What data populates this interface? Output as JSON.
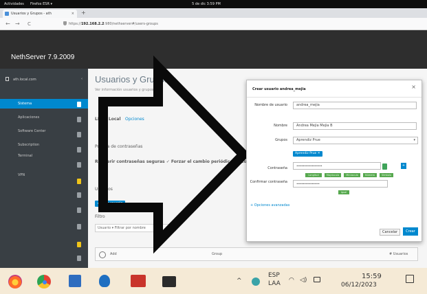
{
  "gnome": {
    "activities": "Actividades",
    "app_name": "Firefox ESR ▾",
    "clock": "5 de dic  3:59 PM"
  },
  "browser": {
    "tab_title": "Usuarios y Grupos - ath",
    "tab_close": "×",
    "new_tab": "+",
    "nav_back": "←",
    "nav_forward": "→",
    "nav_reload": "C",
    "url_prefix": "https://",
    "url_host": "192.168.2.2",
    "url_path": ":980/nethserver#/users-groups"
  },
  "app": {
    "brand": "NethServer 7.9.2009"
  },
  "sidebar": {
    "host": "ath.local.com",
    "host_arrow": "‹",
    "items": [
      {
        "label": "Sistema"
      },
      {
        "label": "Aplicaciones"
      },
      {
        "label": "Software Center"
      },
      {
        "label": "Subscription"
      },
      {
        "label": "Terminal"
      },
      {
        "label": "VPN"
      }
    ]
  },
  "page": {
    "title": "Usuarios y Grupos",
    "subtitle": "Ver información usuarios y grupos",
    "ldap_label": "LDAP Local",
    "ldap_link": "Opciones",
    "policy_heading": "Política de contraseñas",
    "policy_text": "Requerir contraseñas seguras  ✓  Forzar el cambio periódico de contraseña",
    "users_heading": "Usuarios",
    "users_button": "Añadir usuario",
    "filter_label": "Filtro",
    "filter_placeholder": "Usuario  ▾   Filtrar por nombre",
    "add_row": "Add",
    "footer_mid": "Group",
    "footer_right": "# Usuarios"
  },
  "modal": {
    "title": "Crear usuario andrea_mejia",
    "close": "×",
    "fields": {
      "username_label": "Nombre de usuario",
      "username_value": "andrea_mejia",
      "fullname_label": "Nombre",
      "fullname_value": "Andrea Mejia Mejia B",
      "groups_label": "Grupos",
      "groups_value": "Aprendiz Prue",
      "group_chip": "Aprendiz Prue ✕",
      "password_label": "Contraseña",
      "password_value": "••••••••••••••••••••",
      "confirm_label": "Confirmar contraseña",
      "confirm_value": "••••••••••••••••••"
    },
    "strength_labels": [
      "Longitud",
      "Mayúscula",
      "Minúscula",
      "Número",
      "Símbolo"
    ],
    "match_label": "Igual",
    "advanced_link": "+ Opciones avanzadas",
    "cancel": "Cancelar",
    "save": "Crear"
  },
  "taskbar": {
    "lang_top": "ESP",
    "lang_bottom": "LAA",
    "time": "15:59",
    "date": "06/12/2023",
    "tray_chevron": "^"
  },
  "colors": {
    "accent": "#0088ce",
    "header": "#2e2e2e",
    "sidebar": "#393f44",
    "taskbar": "#f5ead6",
    "success": "#57a84f"
  }
}
